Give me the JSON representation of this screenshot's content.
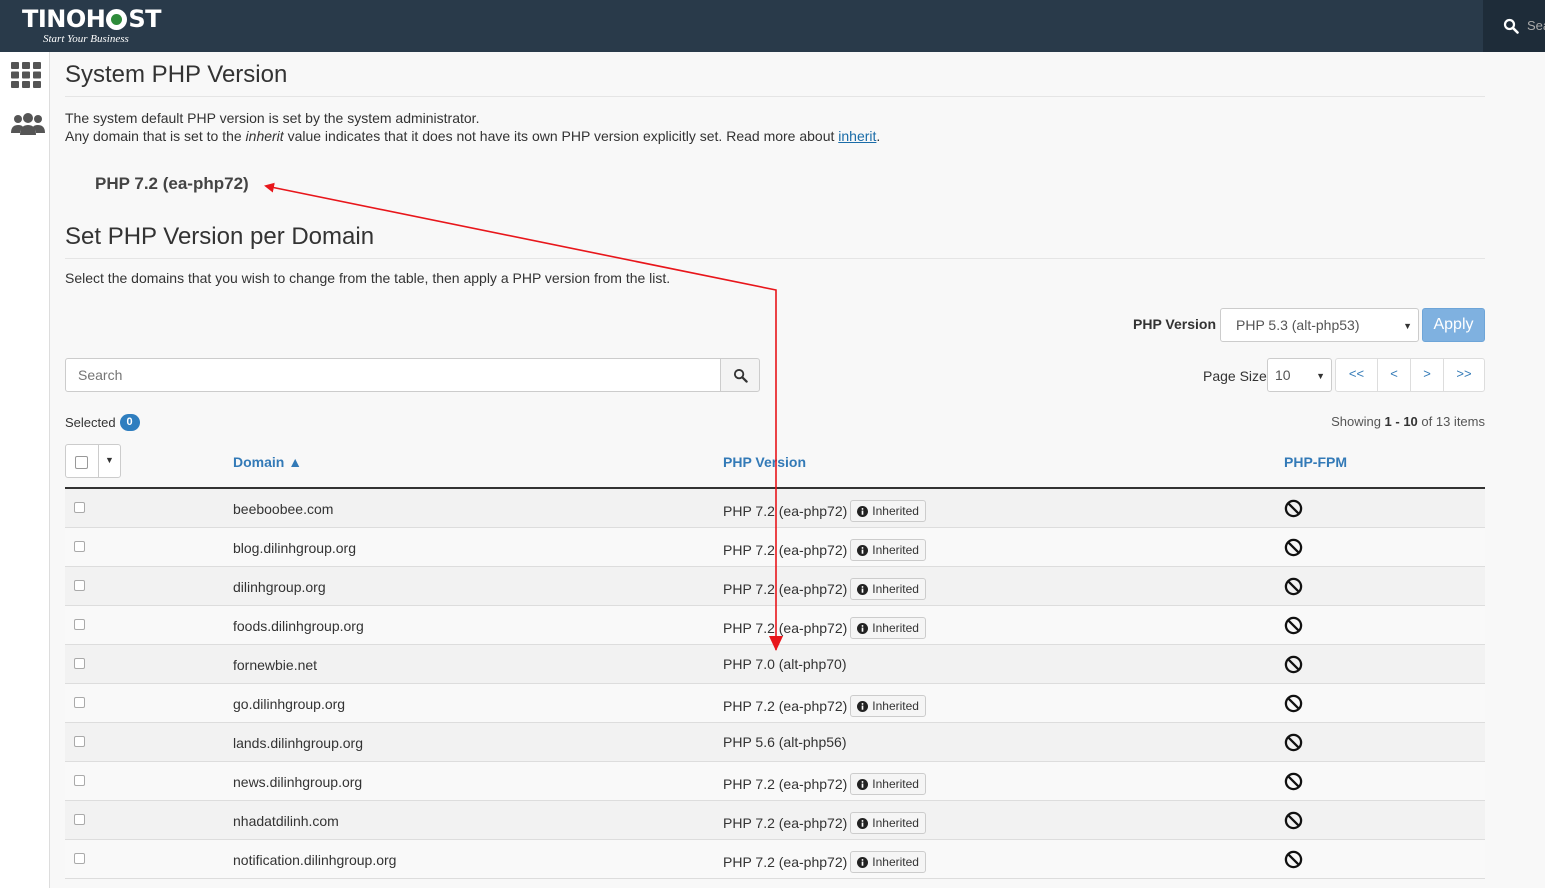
{
  "brand": {
    "name_part1": "TINOH",
    "name_part2": "ST",
    "tagline": "Start Your Business"
  },
  "topbar": {
    "search_placeholder": "Sea"
  },
  "sidebar": {
    "items": [
      {
        "icon": "grid-icon"
      },
      {
        "icon": "users-icon"
      }
    ]
  },
  "page": {
    "title": "System PHP Version",
    "desc_line1": "The system default PHP version is set by the system administrator.",
    "desc_line2_a": "Any domain that is set to the ",
    "desc_line2_em": "inherit",
    "desc_line2_b": " value indicates that it does not have its own PHP version explicitly set. Read more about ",
    "desc_line2_link": "inherit",
    "desc_line2_end": ".",
    "system_version": "PHP 7.2 (ea-php72)",
    "section_title": "Set PHP Version per Domain",
    "section_desc": "Select the domains that you wish to change from the table, then apply a PHP version from the list."
  },
  "controls": {
    "php_version_label": "PHP Version",
    "php_version_selected": "PHP 5.3 (alt-php53)",
    "apply_label": "Apply",
    "search_placeholder": "Search",
    "page_size_label": "Page Size",
    "page_size_value": "10",
    "pager": {
      "first": "<<",
      "prev": "<",
      "next": ">",
      "last": ">>"
    }
  },
  "status": {
    "selected_label": "Selected",
    "selected_count": "0",
    "showing_prefix": "Showing ",
    "showing_range": "1 - 10",
    "showing_suffix": " of 13 items"
  },
  "table": {
    "headers": {
      "domain": "Domain ▲",
      "php_version": "PHP Version",
      "php_fpm": "PHP-FPM"
    },
    "inherited_label": "Inherited",
    "rows": [
      {
        "domain": "beeboobee.com",
        "version": "PHP 7.2 (ea-php72)",
        "inherited": true
      },
      {
        "domain": "blog.dilinhgroup.org",
        "version": "PHP 7.2 (ea-php72)",
        "inherited": true
      },
      {
        "domain": "dilinhgroup.org",
        "version": "PHP 7.2 (ea-php72)",
        "inherited": true
      },
      {
        "domain": "foods.dilinhgroup.org",
        "version": "PHP 7.2 (ea-php72)",
        "inherited": true
      },
      {
        "domain": "fornewbie.net",
        "version": "PHP 7.0 (alt-php70)",
        "inherited": false
      },
      {
        "domain": "go.dilinhgroup.org",
        "version": "PHP 7.2 (ea-php72)",
        "inherited": true
      },
      {
        "domain": "lands.dilinhgroup.org",
        "version": "PHP 5.6 (alt-php56)",
        "inherited": false
      },
      {
        "domain": "news.dilinhgroup.org",
        "version": "PHP 7.2 (ea-php72)",
        "inherited": true
      },
      {
        "domain": "nhadatdilinh.com",
        "version": "PHP 7.2 (ea-php72)",
        "inherited": true
      },
      {
        "domain": "notification.dilinhgroup.org",
        "version": "PHP 7.2 (ea-php72)",
        "inherited": true
      }
    ]
  },
  "colors": {
    "topbar": "#293a4a",
    "link": "#337ab7",
    "apply": "#7fb1e0",
    "badge": "#2f7ebf",
    "annotation_arrow": "#e8161b"
  }
}
